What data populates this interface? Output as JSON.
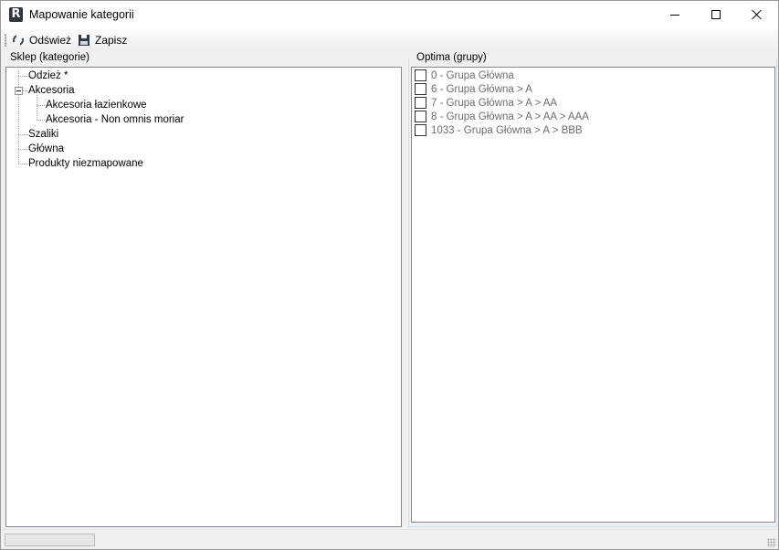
{
  "window": {
    "title": "Mapowanie kategorii",
    "icon": "app-r-icon"
  },
  "toolbar": {
    "refresh_label": "Odśwież",
    "save_label": "Zapisz"
  },
  "left_panel": {
    "label": "Sklep (kategorie)",
    "tree": [
      {
        "label": "Odzież *",
        "level": 0,
        "expanded": false
      },
      {
        "label": "Akcesoria",
        "level": 0,
        "expanded": true
      },
      {
        "label": "Akcesoria łazienkowe",
        "level": 1
      },
      {
        "label": "Akcesoria - Non omnis moriar",
        "level": 1
      },
      {
        "label": "Szaliki",
        "level": 0
      },
      {
        "label": "Główna",
        "level": 0
      },
      {
        "label": "Produkty niezmapowane",
        "level": 0
      }
    ]
  },
  "right_panel": {
    "label": "Optima (grupy)",
    "items": [
      {
        "label": "0 - Grupa Główna",
        "checked": false
      },
      {
        "label": "6 - Grupa Główna > A",
        "checked": false
      },
      {
        "label": "7 - Grupa Główna > A > AA",
        "checked": false
      },
      {
        "label": "8 - Grupa Główna > A > AA > AAA",
        "checked": false
      },
      {
        "label": "1033 - Grupa Główna > A > BBB",
        "checked": false
      }
    ]
  },
  "statusbar": {
    "progress": 0
  }
}
